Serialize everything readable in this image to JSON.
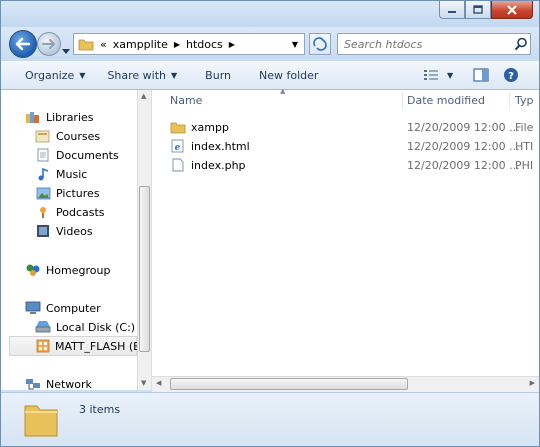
{
  "window": {
    "minimize_icon": "minimize-icon",
    "maximize_icon": "maximize-icon",
    "close_icon": "close-icon"
  },
  "address": {
    "overflow": "«",
    "crumbs": [
      "xampplite",
      "htdocs"
    ],
    "search_placeholder": "Search htdocs"
  },
  "toolbar": {
    "organize": "Organize",
    "share_with": "Share with",
    "burn": "Burn",
    "new_folder": "New folder"
  },
  "sidebar": {
    "libraries": "Libraries",
    "courses": "Courses",
    "documents": "Documents",
    "music": "Music",
    "pictures": "Pictures",
    "podcasts": "Podcasts",
    "videos": "Videos",
    "homegroup": "Homegroup",
    "computer": "Computer",
    "local_disk": "Local Disk (C:)",
    "matt_flash": "MATT_FLASH (E:",
    "network": "Network"
  },
  "columns": {
    "name": "Name",
    "date_modified": "Date modified",
    "type": "Typ"
  },
  "files": [
    {
      "name": "xampp",
      "date": "12/20/2009 12:00 ...",
      "type": "File",
      "icon": "folder-icon"
    },
    {
      "name": "index.html",
      "date": "12/20/2009 12:00 ...",
      "type": "HTI",
      "icon": "html-file-icon"
    },
    {
      "name": "index.php",
      "date": "12/20/2009 12:00 ...",
      "type": "PHI",
      "icon": "file-icon"
    }
  ],
  "status": {
    "count": "3 items"
  },
  "colors": {
    "chrome": "#cfe0f2",
    "accent": "#1e395b",
    "folder": "#e8c15a"
  }
}
